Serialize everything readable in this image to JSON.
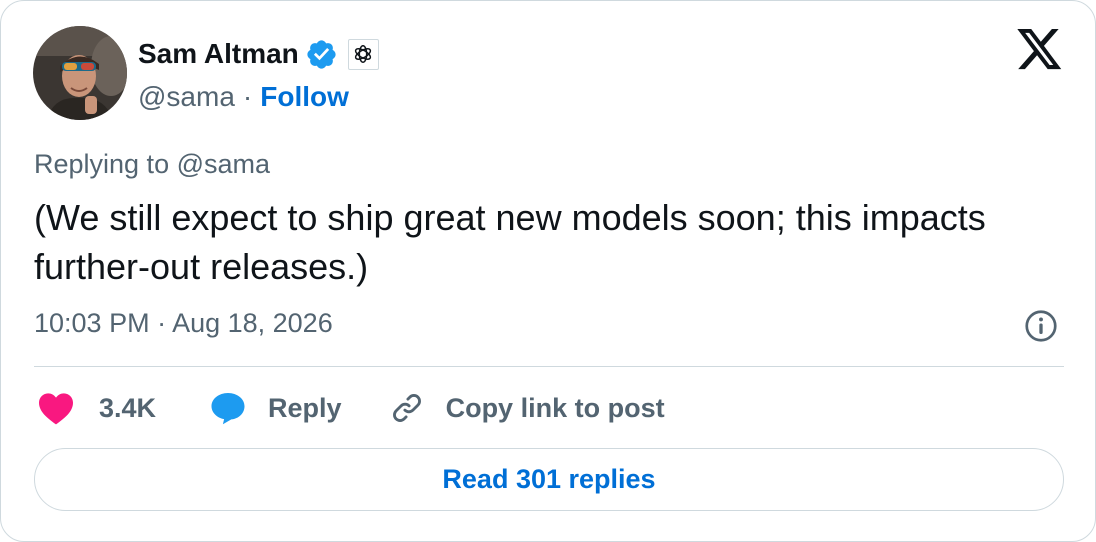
{
  "author": {
    "name": "Sam Altman",
    "handle": "@sama",
    "separator": "·",
    "follow_label": "Follow",
    "verified_icon": "verified-badge-icon",
    "affiliation_icon": "openai-logo-icon"
  },
  "platform_icon": "x-logo-icon",
  "reply_context": {
    "prefix": "Replying to",
    "handle": "@sama"
  },
  "tweet": {
    "text": "(We still expect to ship great new models soon; this impacts further-out releases.)",
    "timestamp": "10:03 PM · Aug 18, 2026"
  },
  "actions": {
    "likes": "3.4K",
    "reply_label": "Reply",
    "copy_link_label": "Copy link to post"
  },
  "read_replies_label": "Read 301 replies",
  "colors": {
    "text_primary": "#0f1419",
    "text_secondary": "#536471",
    "link_blue": "#006fd6",
    "verified_blue": "#1d9bf0",
    "heart_pink": "#f91880",
    "border": "#cfd9de"
  }
}
